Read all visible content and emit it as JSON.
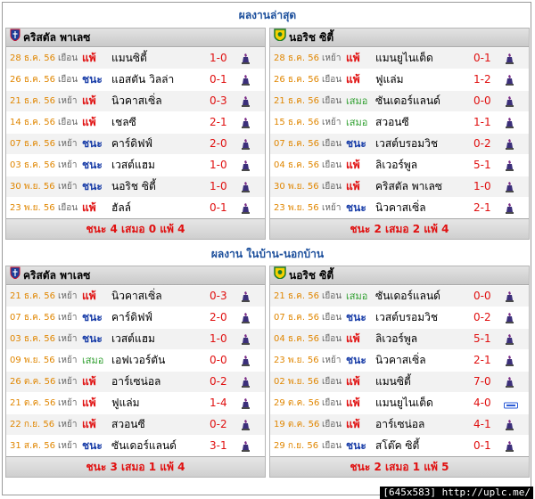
{
  "titles": {
    "recent": "ผลงานล่าสุด",
    "homeaway": "ผลงาน ในบ้าน-นอกบ้าน"
  },
  "colors": {
    "title": "#1c4f9c",
    "date": "#e08600",
    "loss": "#e01010",
    "win": "#1a3ea8",
    "draw": "#2f9f2f"
  },
  "team_left": {
    "name": "คริสตัล พาเลซ",
    "crest_icon": "crystal-palace-crest-icon"
  },
  "team_right": {
    "name": "นอริช ซิตี้",
    "crest_icon": "norwich-city-crest-icon"
  },
  "recent": {
    "left": {
      "rows": [
        {
          "date": "28 ธ.ค. 56",
          "venue": "เยือน",
          "result": "แพ้",
          "r": "L",
          "opponent": "แมนซิตี้",
          "score": "1-0",
          "comp": "league-trophy-icon"
        },
        {
          "date": "26 ธ.ค. 56",
          "venue": "เยือน",
          "result": "ชนะ",
          "r": "W",
          "opponent": "แอสตัน วิลล่า",
          "score": "0-1",
          "comp": "league-trophy-icon"
        },
        {
          "date": "21 ธ.ค. 56",
          "venue": "เหย้า",
          "result": "แพ้",
          "r": "L",
          "opponent": "นิวคาสเซิ่ล",
          "score": "0-3",
          "comp": "league-trophy-icon"
        },
        {
          "date": "14 ธ.ค. 56",
          "venue": "เยือน",
          "result": "แพ้",
          "r": "L",
          "opponent": "เชลซี",
          "score": "2-1",
          "comp": "league-trophy-icon"
        },
        {
          "date": "07 ธ.ค. 56",
          "venue": "เหย้า",
          "result": "ชนะ",
          "r": "W",
          "opponent": "คาร์ดิฟฟ์",
          "score": "2-0",
          "comp": "league-trophy-icon"
        },
        {
          "date": "03 ธ.ค. 56",
          "venue": "เหย้า",
          "result": "ชนะ",
          "r": "W",
          "opponent": "เวสต์แฮม",
          "score": "1-0",
          "comp": "league-trophy-icon"
        },
        {
          "date": "30 พ.ย. 56",
          "venue": "เหย้า",
          "result": "ชนะ",
          "r": "W",
          "opponent": "นอริช ซิตี้",
          "score": "1-0",
          "comp": "league-trophy-icon"
        },
        {
          "date": "23 พ.ย. 56",
          "venue": "เยือน",
          "result": "แพ้",
          "r": "L",
          "opponent": "ฮัลล์",
          "score": "0-1",
          "comp": "league-trophy-icon"
        }
      ],
      "summary": "ชนะ 4 เสมอ 0 แพ้ 4"
    },
    "right": {
      "rows": [
        {
          "date": "28 ธ.ค. 56",
          "venue": "เหย้า",
          "result": "แพ้",
          "r": "L",
          "opponent": "แมนยูไนเต็ด",
          "score": "0-1",
          "comp": "league-trophy-icon"
        },
        {
          "date": "26 ธ.ค. 56",
          "venue": "เยือน",
          "result": "แพ้",
          "r": "L",
          "opponent": "ฟูแล่ม",
          "score": "1-2",
          "comp": "league-trophy-icon"
        },
        {
          "date": "21 ธ.ค. 56",
          "venue": "เยือน",
          "result": "เสมอ",
          "r": "D",
          "opponent": "ซันเดอร์แลนด์",
          "score": "0-0",
          "comp": "league-trophy-icon"
        },
        {
          "date": "15 ธ.ค. 56",
          "venue": "เหย้า",
          "result": "เสมอ",
          "r": "D",
          "opponent": "สวอนซี",
          "score": "1-1",
          "comp": "league-trophy-icon"
        },
        {
          "date": "07 ธ.ค. 56",
          "venue": "เยือน",
          "result": "ชนะ",
          "r": "W",
          "opponent": "เวสต์บรอมวิช",
          "score": "0-2",
          "comp": "league-trophy-icon"
        },
        {
          "date": "04 ธ.ค. 56",
          "venue": "เยือน",
          "result": "แพ้",
          "r": "L",
          "opponent": "ลิเวอร์พูล",
          "score": "5-1",
          "comp": "league-trophy-icon"
        },
        {
          "date": "30 พ.ย. 56",
          "venue": "เยือน",
          "result": "แพ้",
          "r": "L",
          "opponent": "คริสตัล พาเลซ",
          "score": "1-0",
          "comp": "league-trophy-icon"
        },
        {
          "date": "23 พ.ย. 56",
          "venue": "เหย้า",
          "result": "ชนะ",
          "r": "W",
          "opponent": "นิวคาสเซิ่ล",
          "score": "2-1",
          "comp": "league-trophy-icon"
        }
      ],
      "summary": "ชนะ 2 เสมอ 2 แพ้ 4"
    }
  },
  "homeaway": {
    "left": {
      "rows": [
        {
          "date": "21 ธ.ค. 56",
          "venue": "เหย้า",
          "result": "แพ้",
          "r": "L",
          "opponent": "นิวคาสเซิ่ล",
          "score": "0-3",
          "comp": "league-trophy-icon"
        },
        {
          "date": "07 ธ.ค. 56",
          "venue": "เหย้า",
          "result": "ชนะ",
          "r": "W",
          "opponent": "คาร์ดิฟฟ์",
          "score": "2-0",
          "comp": "league-trophy-icon"
        },
        {
          "date": "03 ธ.ค. 56",
          "venue": "เหย้า",
          "result": "ชนะ",
          "r": "W",
          "opponent": "เวสต์แฮม",
          "score": "1-0",
          "comp": "league-trophy-icon"
        },
        {
          "date": "09 พ.ย. 56",
          "venue": "เหย้า",
          "result": "เสมอ",
          "r": "D",
          "opponent": "เอฟเวอร์ตัน",
          "score": "0-0",
          "comp": "league-trophy-icon"
        },
        {
          "date": "26 ต.ค. 56",
          "venue": "เหย้า",
          "result": "แพ้",
          "r": "L",
          "opponent": "อาร์เซน่อล",
          "score": "0-2",
          "comp": "league-trophy-icon"
        },
        {
          "date": "21 ต.ค. 56",
          "venue": "เหย้า",
          "result": "แพ้",
          "r": "L",
          "opponent": "ฟูแล่ม",
          "score": "1-4",
          "comp": "league-trophy-icon"
        },
        {
          "date": "22 ก.ย. 56",
          "venue": "เหย้า",
          "result": "แพ้",
          "r": "L",
          "opponent": "สวอนซี",
          "score": "0-2",
          "comp": "league-trophy-icon"
        },
        {
          "date": "31 ส.ค. 56",
          "venue": "เหย้า",
          "result": "ชนะ",
          "r": "W",
          "opponent": "ซันเดอร์แลนด์",
          "score": "3-1",
          "comp": "league-trophy-icon"
        }
      ],
      "summary": "ชนะ 3 เสมอ 1 แพ้ 4"
    },
    "right": {
      "rows": [
        {
          "date": "21 ธ.ค. 56",
          "venue": "เยือน",
          "result": "เสมอ",
          "r": "D",
          "opponent": "ซันเดอร์แลนด์",
          "score": "0-0",
          "comp": "league-trophy-icon"
        },
        {
          "date": "07 ธ.ค. 56",
          "venue": "เยือน",
          "result": "ชนะ",
          "r": "W",
          "opponent": "เวสต์บรอมวิช",
          "score": "0-2",
          "comp": "league-trophy-icon"
        },
        {
          "date": "04 ธ.ค. 56",
          "venue": "เยือน",
          "result": "แพ้",
          "r": "L",
          "opponent": "ลิเวอร์พูล",
          "score": "5-1",
          "comp": "league-trophy-icon"
        },
        {
          "date": "23 พ.ย. 56",
          "venue": "เหย้า",
          "result": "ชนะ",
          "r": "W",
          "opponent": "นิวคาสเซิ่ล",
          "score": "2-1",
          "comp": "league-trophy-icon"
        },
        {
          "date": "02 พ.ย. 56",
          "venue": "เยือน",
          "result": "แพ้",
          "r": "L",
          "opponent": "แมนซิตี้",
          "score": "7-0",
          "comp": "league-trophy-icon"
        },
        {
          "date": "29 ต.ค. 56",
          "venue": "เยือน",
          "result": "แพ้",
          "r": "L",
          "opponent": "แมนยูไนเต็ด",
          "score": "4-0",
          "comp": "capital-one-cup-icon"
        },
        {
          "date": "19 ต.ค. 56",
          "venue": "เยือน",
          "result": "แพ้",
          "r": "L",
          "opponent": "อาร์เซน่อล",
          "score": "4-1",
          "comp": "league-trophy-icon"
        },
        {
          "date": "29 ก.ย. 56",
          "venue": "เยือน",
          "result": "ชนะ",
          "r": "W",
          "opponent": "สโต๊ค ซิตี้",
          "score": "0-1",
          "comp": "league-trophy-icon"
        }
      ],
      "summary": "ชนะ 2 เสมอ 1 แพ้ 5"
    }
  },
  "watermark": "[645x583] http://uplc.me/"
}
